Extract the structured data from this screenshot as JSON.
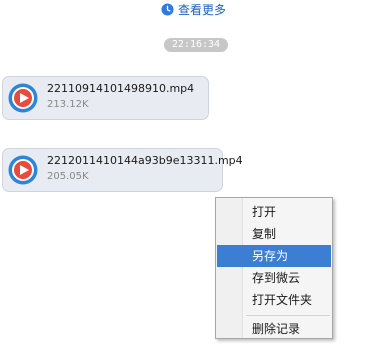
{
  "history": {
    "view_more_label": "查看更多",
    "icon": "clock-icon"
  },
  "timestamp": "22:16:34",
  "messages": [
    {
      "file_name": "22110914101498910.mp4",
      "file_size": "213.12K",
      "icon": "video-play-icon"
    },
    {
      "file_name": "2212011410144a93b9e13311.mp4",
      "file_size": "205.05K",
      "icon": "video-play-icon"
    }
  ],
  "context_menu": {
    "items": [
      {
        "label": "打开",
        "active": false
      },
      {
        "label": "复制",
        "active": false
      },
      {
        "label": "另存为",
        "active": true
      },
      {
        "label": "存到微云",
        "active": false
      },
      {
        "label": "打开文件夹",
        "active": false
      },
      {
        "label": "删除记录",
        "active": false
      }
    ]
  },
  "colors": {
    "link": "#1a62c2",
    "bubble_bg": "#e8ebf1",
    "menu_highlight": "#3b7ed4",
    "time_pill": "#c7c7c7"
  }
}
